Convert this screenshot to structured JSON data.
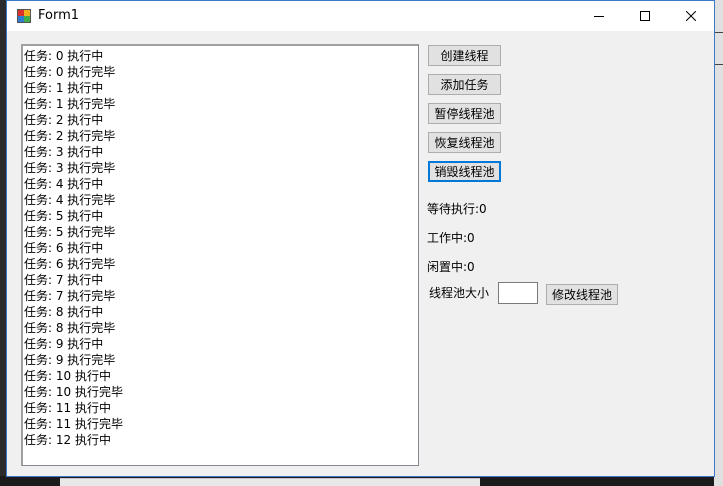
{
  "window": {
    "title": "Form1"
  },
  "log": {
    "items": [
      "任务: 0 执行中",
      "任务: 0 执行完毕",
      "任务: 1 执行中",
      "任务: 1 执行完毕",
      "任务: 2 执行中",
      "任务: 2 执行完毕",
      "任务: 3 执行中",
      "任务: 3 执行完毕",
      "任务: 4 执行中",
      "任务: 4 执行完毕",
      "任务: 5 执行中",
      "任务: 5 执行完毕",
      "任务: 6 执行中",
      "任务: 6 执行完毕",
      "任务: 7 执行中",
      "任务: 7 执行完毕",
      "任务: 8 执行中",
      "任务: 8 执行完毕",
      "任务: 9 执行中",
      "任务: 9 执行完毕",
      "任务: 10 执行中",
      "任务: 10 执行完毕",
      "任务: 11 执行中",
      "任务: 11 执行完毕",
      "任务: 12 执行中"
    ]
  },
  "buttons": {
    "create": "创建线程",
    "add_task": "添加任务",
    "pause": "暂停线程池",
    "resume": "恢复线程池",
    "destroy": "销毁线程池",
    "modify": "修改线程池"
  },
  "status": {
    "waiting": "等待执行:0",
    "working": "工作中:0",
    "idle": "闲置中:0"
  },
  "pool_size": {
    "label": "线程池大小",
    "value": ""
  },
  "icons": {
    "app": "form-app-icon",
    "minimize": "minimize-icon",
    "maximize": "maximize-icon",
    "close": "close-icon"
  }
}
